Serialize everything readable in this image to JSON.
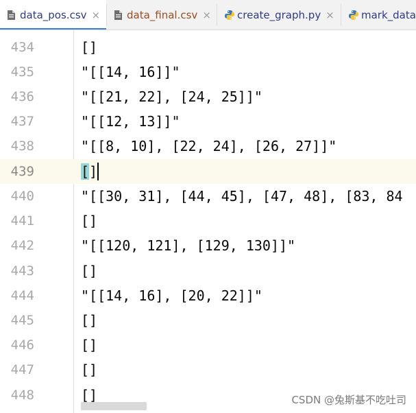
{
  "tabs": [
    {
      "label": "data_pos.csv",
      "icon": "csv-file-icon",
      "color": "#2d3a8c",
      "active": true
    },
    {
      "label": "data_final.csv",
      "icon": "csv-file-icon",
      "color": "#a04a1e",
      "active": false
    },
    {
      "label": "create_graph.py",
      "icon": "python-file-icon",
      "color": "#2d3a8c",
      "active": false
    },
    {
      "label": "mark_data.",
      "icon": "python-file-icon",
      "color": "#2d3a8c",
      "active": false
    }
  ],
  "close_glyph": "×",
  "editor": {
    "current_line": "439",
    "lines": [
      {
        "num": "434",
        "text": "[]"
      },
      {
        "num": "435",
        "text": "\"[[14, 16]]\""
      },
      {
        "num": "436",
        "text": "\"[[21, 22], [24, 25]]\""
      },
      {
        "num": "437",
        "text": "\"[[12, 13]]\""
      },
      {
        "num": "438",
        "text": "\"[[8, 10], [22, 24], [26, 27]]\""
      },
      {
        "num": "439",
        "text_a": "[",
        "text_b": "]"
      },
      {
        "num": "440",
        "text": "\"[[30, 31], [44, 45], [47, 48], [83, 84"
      },
      {
        "num": "441",
        "text": "[]"
      },
      {
        "num": "442",
        "text": "\"[[120, 121], [129, 130]]\""
      },
      {
        "num": "443",
        "text": "[]"
      },
      {
        "num": "444",
        "text": "\"[[14, 16], [20, 22]]\""
      },
      {
        "num": "445",
        "text": "[]"
      },
      {
        "num": "446",
        "text": "[]"
      },
      {
        "num": "447",
        "text": "[]"
      },
      {
        "num": "448",
        "text": "[]"
      }
    ]
  },
  "watermark": "CSDN @兔斯基不吃吐司",
  "colors": {
    "accent": "#4083c9",
    "current_line_bg": "#fcfaed",
    "brace_match": "#99d7d7"
  }
}
